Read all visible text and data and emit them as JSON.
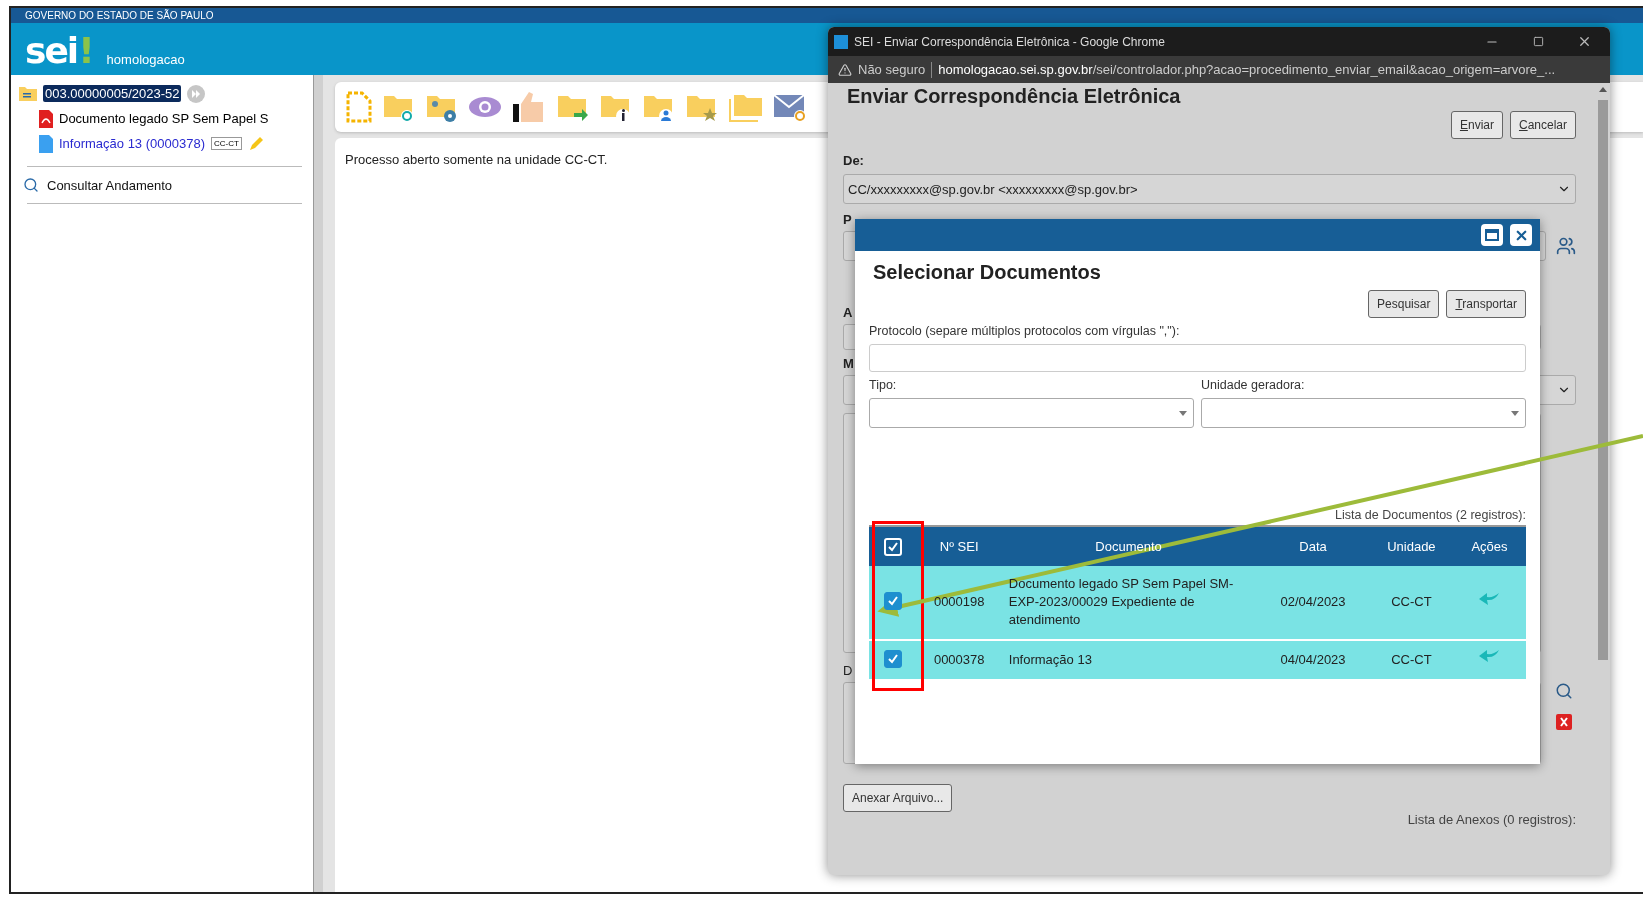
{
  "header": {
    "government": "GOVERNO DO ESTADO DE SÃO PAULO",
    "logo_text": "sei",
    "logo_mark": "!",
    "environment": "homologacao"
  },
  "tree": {
    "process": {
      "number": "003.00000005/2023-52",
      "selected": true
    },
    "documents": [
      {
        "kind": "pdf",
        "title": "Documento legado SP Sem Papel S",
        "selected": false
      },
      {
        "kind": "doc",
        "title": "Informação 13 (0000378)",
        "badge": "CC-CT",
        "selected": true
      }
    ]
  },
  "sidebar_link": "Consultar Andamento",
  "content_message": "Processo aberto somente na unidade CC-CT.",
  "browser": {
    "title": "SEI - Enviar Correspondência Eletrônica - Google Chrome",
    "security": "Não seguro",
    "url_host": "homologacao.sei.sp.gov.br",
    "url_path": "/sei/controlador.php?acao=procedimento_enviar_email&acao_origem=arvore_..."
  },
  "email_form": {
    "heading": "Enviar Correspondência Eletrônica",
    "buttons": [
      "Enviar",
      "Cancelar"
    ],
    "de_label": "De:",
    "de_value": "CC/xxxxxxxxx@sp.gov.br <xxxxxxxxx@sp.gov.br>",
    "hidden_labels": [
      "P",
      "A",
      "M",
      "D"
    ],
    "attach_button": "Anexar Arquivo...",
    "attachments_caption": "Lista de Anexos (0 registros):"
  },
  "dialog": {
    "title": "Selecionar Documentos",
    "buttons": [
      "Pesquisar",
      "Transportar"
    ],
    "protocolo_label": "Protocolo (separe múltiplos protocolos com vírgulas \",\"):",
    "tipo_label": "Tipo:",
    "unidade_label": "Unidade geradora:",
    "list_caption": "Lista de Documentos (2 registros):",
    "select_all": {
      "checked": true
    },
    "columns": [
      "Nº SEI",
      "Documento",
      "Data",
      "Unidade",
      "Ações"
    ],
    "rows": [
      {
        "checked": true,
        "numero": "0000198",
        "documento": "Documento legado SP Sem Papel SM-EXP-2023/00029 Expediente de atendimento",
        "data": "02/04/2023",
        "unidade": "CC-CT"
      },
      {
        "checked": true,
        "numero": "0000378",
        "documento": "Informação 13",
        "data": "04/04/2023",
        "unidade": "CC-CT"
      }
    ]
  }
}
